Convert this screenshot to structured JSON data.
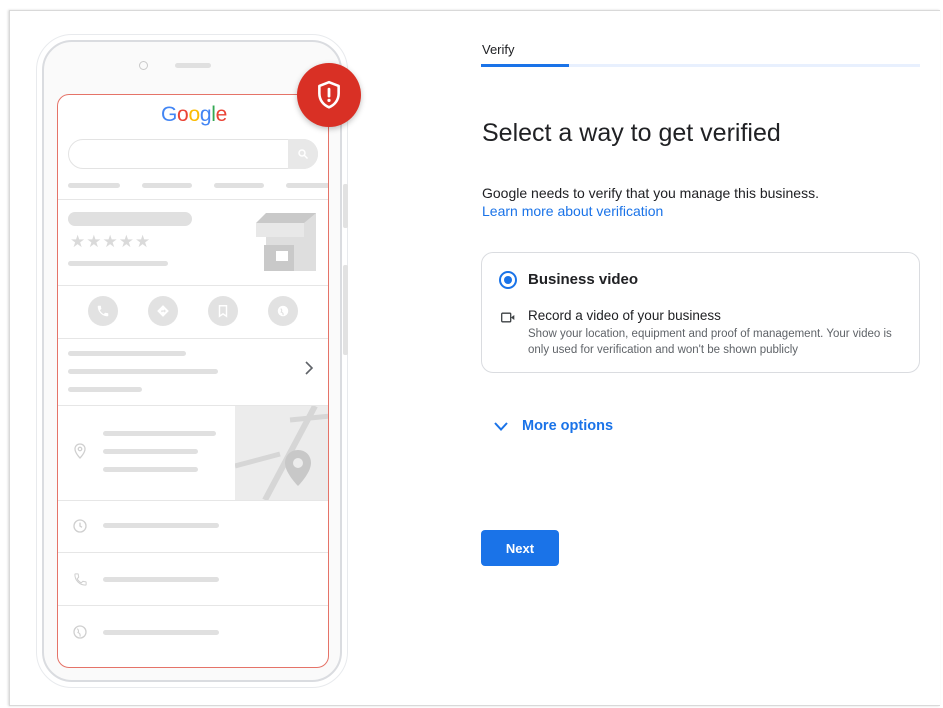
{
  "illustration": {
    "logo_letters": [
      {
        "char": "G",
        "color": "#4285f4"
      },
      {
        "char": "o",
        "color": "#ea4335"
      },
      {
        "char": "o",
        "color": "#fbbc05"
      },
      {
        "char": "g",
        "color": "#4285f4"
      },
      {
        "char": "l",
        "color": "#34a853"
      },
      {
        "char": "e",
        "color": "#ea4335"
      }
    ],
    "rating_stars": "★★★★★",
    "badge_icon": "shield-alert-icon",
    "badge_color": "#d93025",
    "screen_border_color": "#e57368"
  },
  "verify": {
    "tab_label": "Verify",
    "progress_fraction": 0.2,
    "heading": "Select a way to get verified",
    "description": "Google needs to verify that you manage this business.",
    "learn_more_link": "Learn more about verification",
    "option": {
      "title": "Business video",
      "selected": true,
      "icon": "video-camera-icon",
      "subtitle": "Record a video of your business",
      "detail": "Show your location, equipment and proof of management. Your video is only used for verification and won't be shown publicly"
    },
    "more_options_label": "More options",
    "next_label": "Next"
  },
  "colors": {
    "accent": "#1a73e8",
    "text": "#202124",
    "muted": "#5f6368"
  }
}
